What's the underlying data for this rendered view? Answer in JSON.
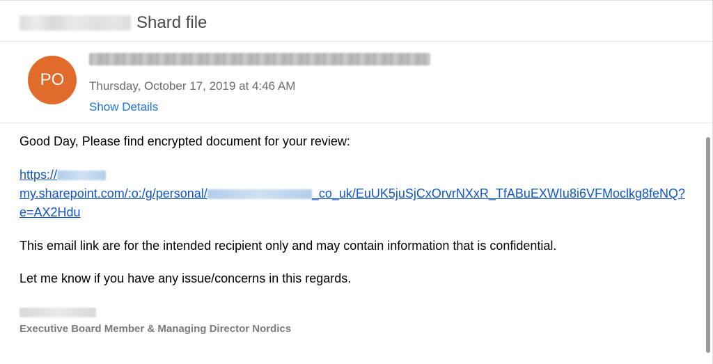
{
  "subject": "Shard file",
  "avatar_initials": "PO",
  "date": "Thursday, October 17, 2019 at 4:46 AM",
  "show_details_label": "Show Details",
  "body": {
    "greeting": "Good Day, Please find encrypted document for your review:",
    "link_prefix": "https://",
    "link_line2_a": "my.sharepoint.com/:o:/g/personal/",
    "link_line2_b": "_co_uk/EuUK5juSjCxOrvrNXxR_TfABuEXWIu8i6VFMoclkg8feNQ?",
    "link_line3": "e=AX2Hdu",
    "disclaimer": "This email link are for the intended recipient only and may contain information that is confidential.",
    "closing": "Let me know if you have any issue/concerns in this regards."
  },
  "signature_title": "Executive Board Member & Managing Director Nordics"
}
